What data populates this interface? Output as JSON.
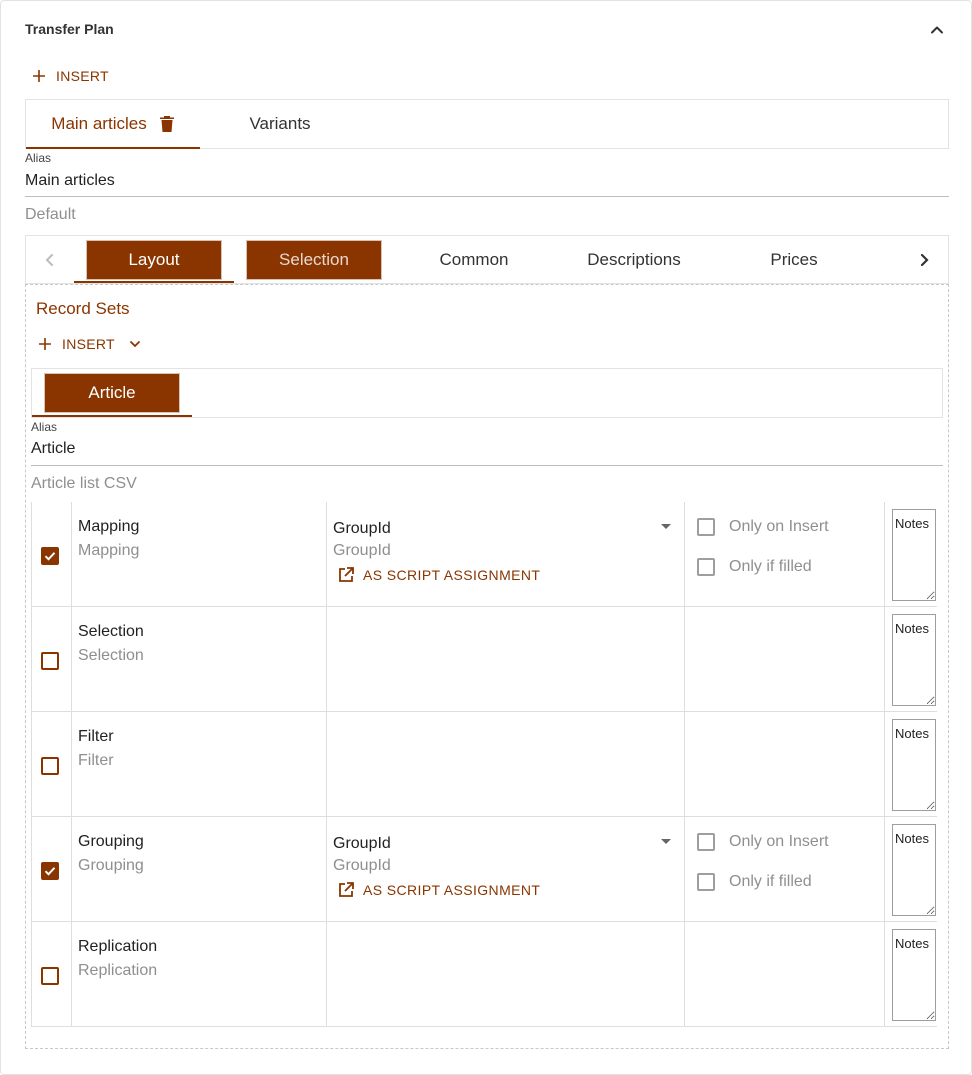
{
  "panel": {
    "title": "Transfer Plan",
    "insert_label": "INSERT"
  },
  "top_tabs": [
    {
      "label": "Main articles"
    },
    {
      "label": "Variants"
    }
  ],
  "alias_field": {
    "label": "Alias",
    "value": "Main articles"
  },
  "default_text": "Default",
  "sub_tabs": [
    {
      "label": "Layout"
    },
    {
      "label": "Selection"
    },
    {
      "label": "Common"
    },
    {
      "label": "Descriptions"
    },
    {
      "label": "Prices"
    }
  ],
  "record_sets": {
    "title": "Record Sets",
    "insert_label": "INSERT",
    "tabs": [
      {
        "label": "Article"
      }
    ],
    "alias_field": {
      "label": "Alias",
      "value": "Article"
    },
    "subtitle": "Article list CSV"
  },
  "rows": [
    {
      "name": "Mapping",
      "sub": "Mapping",
      "checked": true,
      "select_value": "GroupId",
      "select_sub": "GroupId",
      "script_label": "AS SCRIPT ASSIGNMENT",
      "opt_insert": "Only on Insert",
      "opt_filled": "Only if filled",
      "notes_placeholder": "Notes"
    },
    {
      "name": "Selection",
      "sub": "Selection",
      "checked": false,
      "notes_placeholder": "Notes"
    },
    {
      "name": "Filter",
      "sub": "Filter",
      "checked": false,
      "notes_placeholder": "Notes"
    },
    {
      "name": "Grouping",
      "sub": "Grouping",
      "checked": true,
      "select_value": "GroupId",
      "select_sub": "GroupId",
      "script_label": "AS SCRIPT ASSIGNMENT",
      "opt_insert": "Only on Insert",
      "opt_filled": "Only if filled",
      "notes_placeholder": "Notes"
    },
    {
      "name": "Replication",
      "sub": "Replication",
      "checked": false,
      "notes_placeholder": "Notes"
    }
  ],
  "colors": {
    "accent": "#8a3500",
    "border": "#e3e3e3",
    "muted": "#8f8f8f"
  }
}
